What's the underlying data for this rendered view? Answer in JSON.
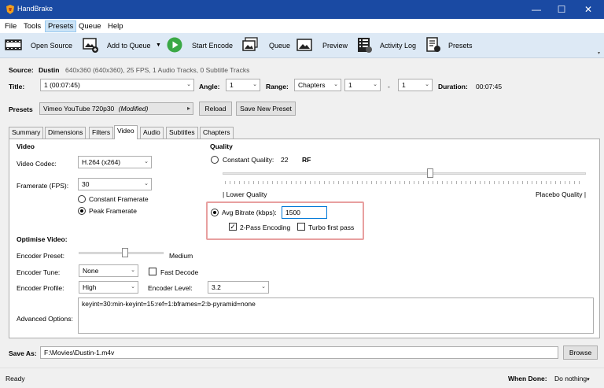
{
  "window": {
    "title": "HandBrake",
    "controls": [
      "—",
      "☐",
      "✕"
    ]
  },
  "menu": [
    "File",
    "Tools",
    "Presets",
    "Queue",
    "Help"
  ],
  "toolbar": {
    "open_source": "Open Source",
    "add_to_queue": "Add to Queue",
    "start_encode": "Start Encode",
    "queue": "Queue",
    "preview": "Preview",
    "activity_log": "Activity Log",
    "presets": "Presets"
  },
  "source": {
    "label": "Source:",
    "name": "Dustin",
    "info": "640x360 (640x360), 25 FPS, 1 Audio Tracks, 0 Subtitle Tracks"
  },
  "title_row": {
    "title_label": "Title:",
    "title_value": "1 (00:07:45)",
    "angle_label": "Angle:",
    "angle_value": "1",
    "range_label": "Range:",
    "range_value": "Chapters",
    "start_value": "1",
    "dash": "-",
    "end_value": "1",
    "duration_label": "Duration:",
    "duration_value": "00:07:45"
  },
  "presets_row": {
    "label": "Presets",
    "preset_name": "Vimeo YouTube 720p30",
    "modified": "(Modified)",
    "reload": "Reload",
    "save_new": "Save New Preset"
  },
  "tabs": [
    "Summary",
    "Dimensions",
    "Filters",
    "Video",
    "Audio",
    "Subtitles",
    "Chapters"
  ],
  "video": {
    "section": "Video",
    "codec_label": "Video Codec:",
    "codec_value": "H.264 (x264)",
    "framerate_label": "Framerate (FPS):",
    "framerate_value": "30",
    "constant_framerate": "Constant Framerate",
    "peak_framerate": "Peak Framerate"
  },
  "quality": {
    "section": "Quality",
    "constant_quality": "Constant Quality:",
    "cq_value": "22",
    "rf": "RF",
    "lower_quality": "| Lower Quality",
    "placebo_quality": "Placebo Quality |",
    "avg_bitrate": "Avg Bitrate (kbps):",
    "bitrate_value": "1500",
    "two_pass": "2-Pass Encoding",
    "turbo": "Turbo first pass",
    "highlight_color": "#e8a0a0"
  },
  "optimise": {
    "section": "Optimise Video:",
    "preset_label": "Encoder Preset:",
    "preset_value": "Medium",
    "tune_label": "Encoder Tune:",
    "tune_value": "None",
    "fast_decode": "Fast Decode",
    "profile_label": "Encoder Profile:",
    "profile_value": "High",
    "level_label": "Encoder Level:",
    "level_value": "3.2",
    "advanced_label": "Advanced Options:",
    "advanced_value": "keyint=30:min-keyint=15:ref=1:bframes=2:b-pyramid=none"
  },
  "save": {
    "label": "Save As:",
    "path": "F:\\Movies\\Dustin-1.m4v",
    "browse": "Browse"
  },
  "status": {
    "text": "Ready",
    "when_done_label": "When Done:",
    "when_done_value": "Do nothing"
  }
}
